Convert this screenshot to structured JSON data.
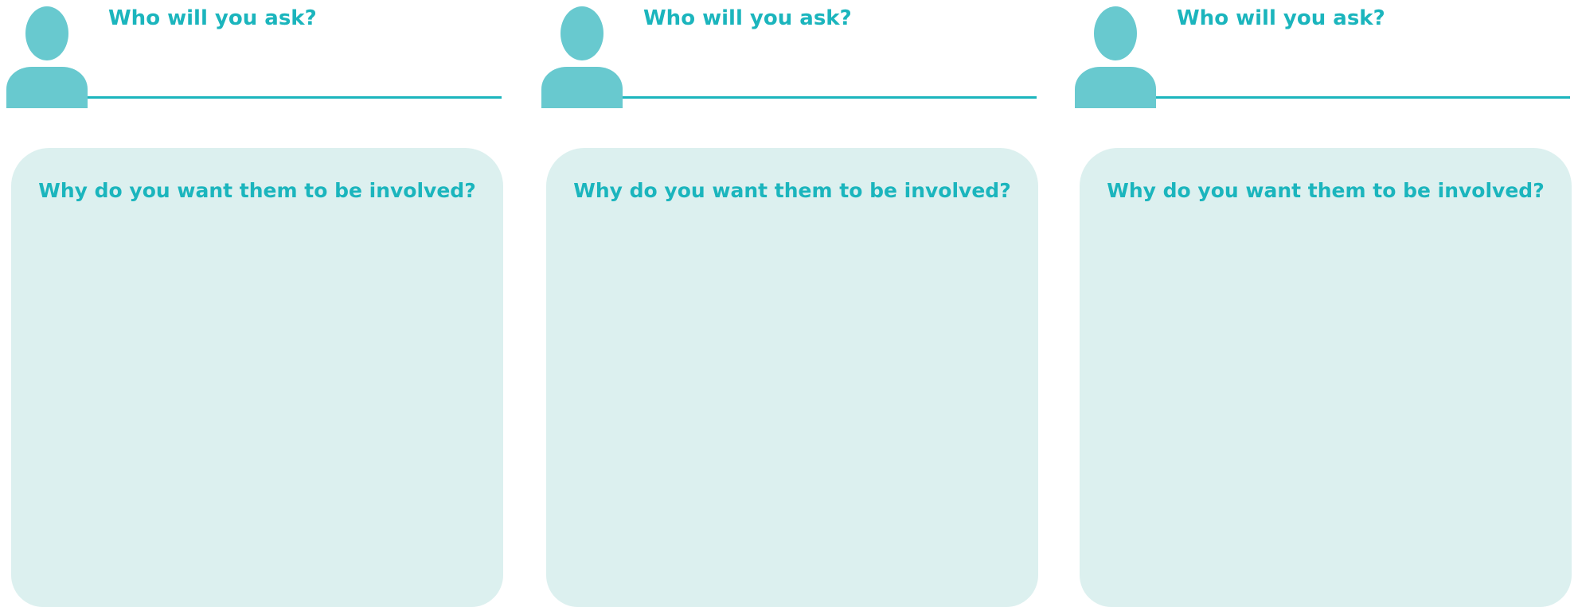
{
  "colors": {
    "accent": "#1bb5bd",
    "avatar": "#68c9cf",
    "box_background": "#dcf0ef"
  },
  "columns": [
    {
      "icon": "person-icon",
      "who_label": "Who will you ask?",
      "why_label": "Why do you want them to be involved?"
    },
    {
      "icon": "person-icon",
      "who_label": "Who will you ask?",
      "why_label": "Why do you want them to be involved?"
    },
    {
      "icon": "person-icon",
      "who_label": "Who will you ask?",
      "why_label": "Why do you want them to be involved?"
    }
  ]
}
